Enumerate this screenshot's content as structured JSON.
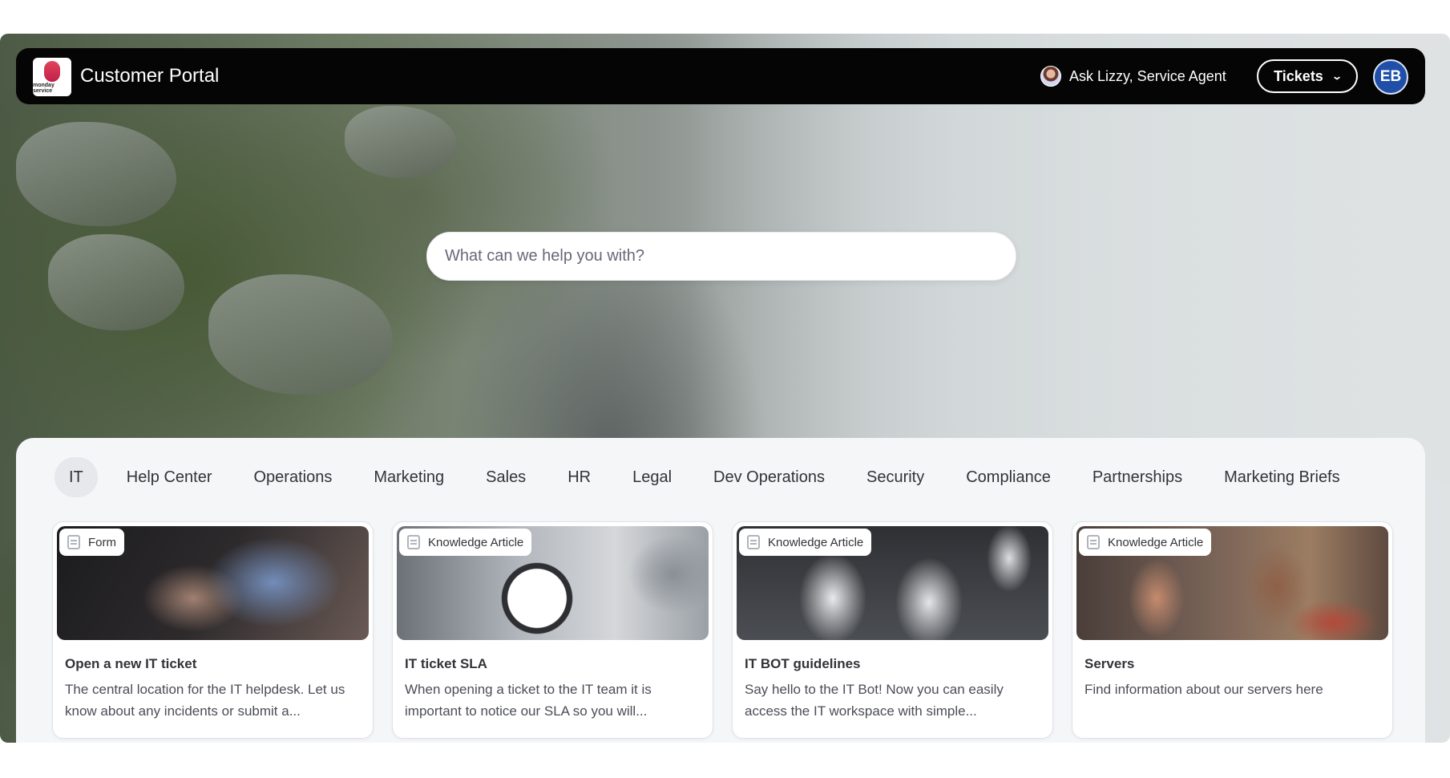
{
  "header": {
    "logo_text": "monday service",
    "title": "Customer Portal",
    "agent_label": "Ask Lizzy, Service Agent",
    "tickets_label": "Tickets",
    "user_initials": "EB"
  },
  "search": {
    "placeholder": "What can we help you with?"
  },
  "tabs": [
    "IT",
    "Help Center",
    "Operations",
    "Marketing",
    "Sales",
    "HR",
    "Legal",
    "Dev Operations",
    "Security",
    "Compliance",
    "Partnerships",
    "Marketing Briefs"
  ],
  "active_tab": "IT",
  "cards": [
    {
      "badge": "Form",
      "title": "Open a new IT ticket",
      "description": "The central location for the IT helpdesk. Let us know about any incidents or submit a..."
    },
    {
      "badge": "Knowledge Article",
      "title": "IT ticket SLA",
      "description": "When opening a ticket to the IT team it is important to notice our SLA so you will..."
    },
    {
      "badge": "Knowledge Article",
      "title": "IT BOT guidelines",
      "description": "Say hello to the IT Bot! Now you can easily access the IT workspace with simple..."
    },
    {
      "badge": "Knowledge Article",
      "title": "Servers",
      "description": "Find information about our servers here"
    }
  ],
  "colors": {
    "topbar": "#050505",
    "avatar": "#1f4fa8",
    "panel": "#f5f6f8"
  }
}
